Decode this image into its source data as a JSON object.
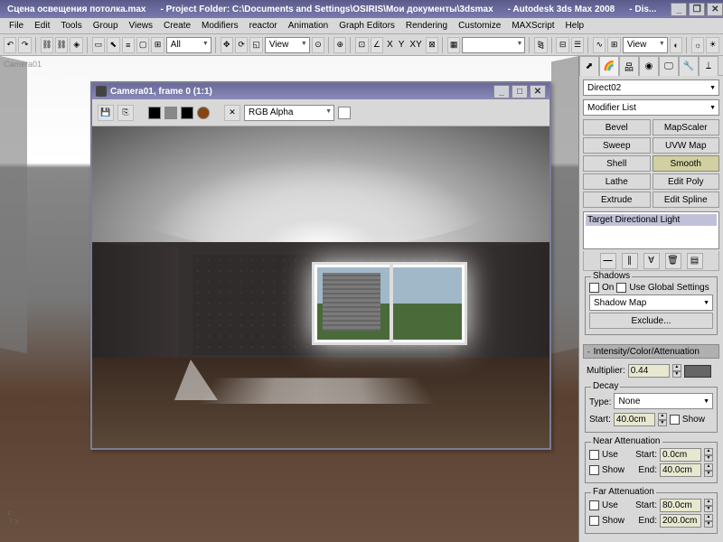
{
  "titlebar": {
    "file": "Сцена освещения потолка.max",
    "folder": "- Project Folder: C:\\Documents and Settings\\OSIRIS\\Мои документы\\3dsmax",
    "app": "- Autodesk 3ds Max 2008",
    "suffix": "- Dis..."
  },
  "menu": [
    "File",
    "Edit",
    "Tools",
    "Group",
    "Views",
    "Create",
    "Modifiers",
    "reactor",
    "Animation",
    "Graph Editors",
    "Rendering",
    "Customize",
    "MAXScript",
    "Help"
  ],
  "toolbar": {
    "view_dropdown": "View",
    "view_dropdown2": "View",
    "xyz": [
      "X",
      "Y",
      "XY"
    ]
  },
  "viewport": {
    "label": "Camera01"
  },
  "render": {
    "title": "Camera01, frame 0 (1:1)",
    "channel": "RGB Alpha"
  },
  "panel": {
    "object_name": "Direct02",
    "modifier_list_label": "Modifier List",
    "buttons": [
      [
        "Bevel",
        "MapScaler"
      ],
      [
        "Sweep",
        "UVW Map"
      ],
      [
        "Shell",
        "Smooth"
      ],
      [
        "Lathe",
        "Edit Poly"
      ],
      [
        "Extrude",
        "Edit Spline"
      ]
    ],
    "stack_entry": "Target Directional Light",
    "shadows": {
      "group": "Shadows",
      "on": "On",
      "global": "Use Global Settings",
      "type": "Shadow Map",
      "exclude": "Exclude..."
    },
    "intensity_header": "Intensity/Color/Attenuation",
    "multiplier_label": "Multiplier:",
    "multiplier_value": "0.44",
    "decay": {
      "group": "Decay",
      "type_label": "Type:",
      "type_value": "None",
      "start_label": "Start:",
      "start_value": "40.0cm",
      "show": "Show"
    },
    "near_atten": {
      "group": "Near Attenuation",
      "use": "Use",
      "show": "Show",
      "start_label": "Start:",
      "start_value": "0.0cm",
      "end_label": "End:",
      "end_value": "40.0cm"
    },
    "far_atten": {
      "group": "Far Attenuation",
      "use": "Use",
      "show": "Show",
      "start_label": "Start:",
      "start_value": "80.0cm",
      "end_label": "End:",
      "end_value": "200.0cm"
    }
  }
}
